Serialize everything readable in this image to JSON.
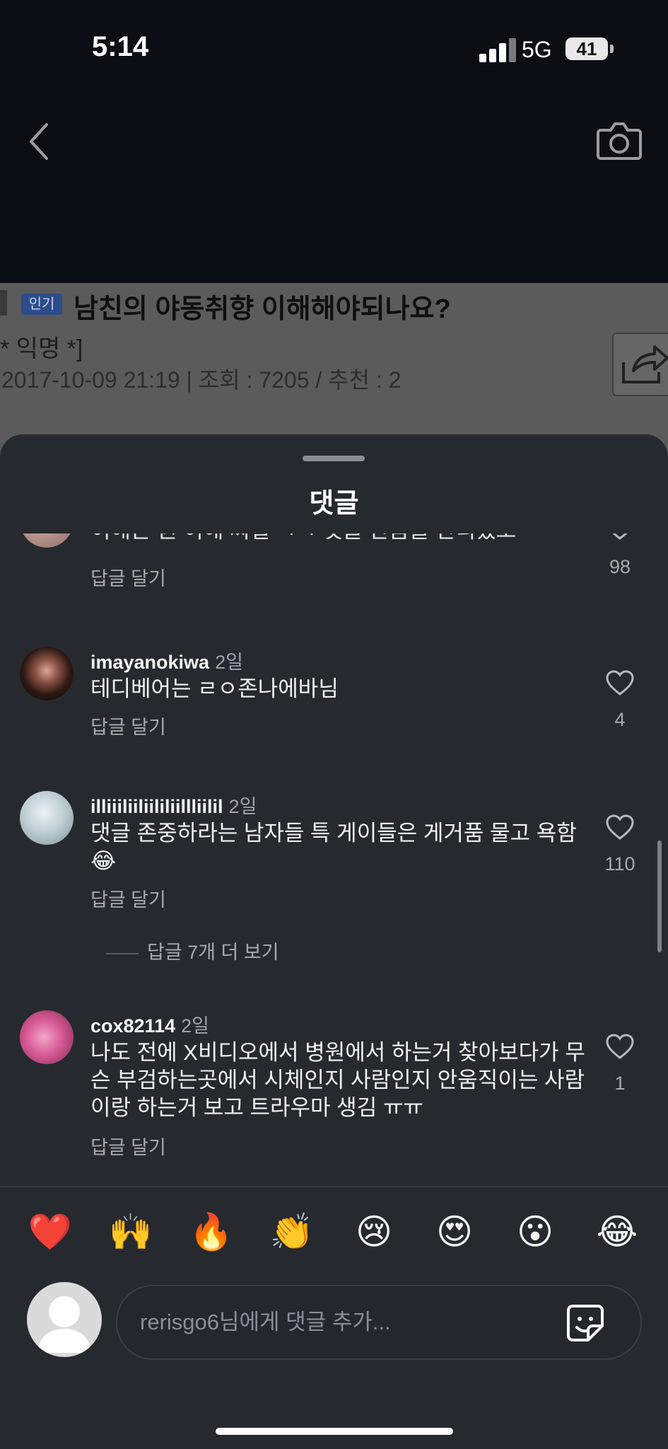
{
  "status_bar": {
    "time": "5:14",
    "network": "5G",
    "battery": "41"
  },
  "post": {
    "badge": "인기",
    "title": "남친의 야동취향 이해해야되나요?",
    "author": "* 익명 *]",
    "meta": "2017-10-09 21:19 | 조회 : 7205 / 추천 : 2"
  },
  "sheet": {
    "title": "댓글"
  },
  "comments": [
    {
      "text": "이해는 뭔 이해 찌질 ㅋㅋ 댓글 반음을 반디었도",
      "reply_label": "답글 달기",
      "likes": "98"
    },
    {
      "user": "imayanokiwa",
      "time": "2일",
      "text": "테디베어는 ㄹㅇ존나에바님",
      "reply_label": "답글 달기",
      "likes": "4"
    },
    {
      "user": "illiiiliiliililiillliilil",
      "time": "2일",
      "text": "댓글 존중하라는 남자들  특 게이들은 게거품 물고 욕함 😂",
      "reply_label": "답글 달기",
      "likes": "110",
      "more_replies": "답글 7개 더 보기"
    },
    {
      "user": "cox82114",
      "time": "2일",
      "text": "나도 전에 X비디오에서 병원에서 하는거 찾아보다가 무슨 부검하는곳에서 시체인지 사람인지 안움직이는 사람이랑 하는거 보고 트라우마 생김 ㅠㅠ",
      "reply_label": "답글 달기",
      "likes": "1"
    }
  ],
  "emoji_bar": [
    "❤️",
    "🙌",
    "🔥",
    "👏",
    "😢",
    "😍",
    "😮",
    "😂"
  ],
  "input": {
    "placeholder": "rerisgo6님에게 댓글 추가..."
  },
  "icons": {
    "back": "chevron-left-icon",
    "camera": "camera-icon",
    "heart": "heart-icon",
    "sticker": "sticker-icon",
    "share": "share-icon"
  }
}
